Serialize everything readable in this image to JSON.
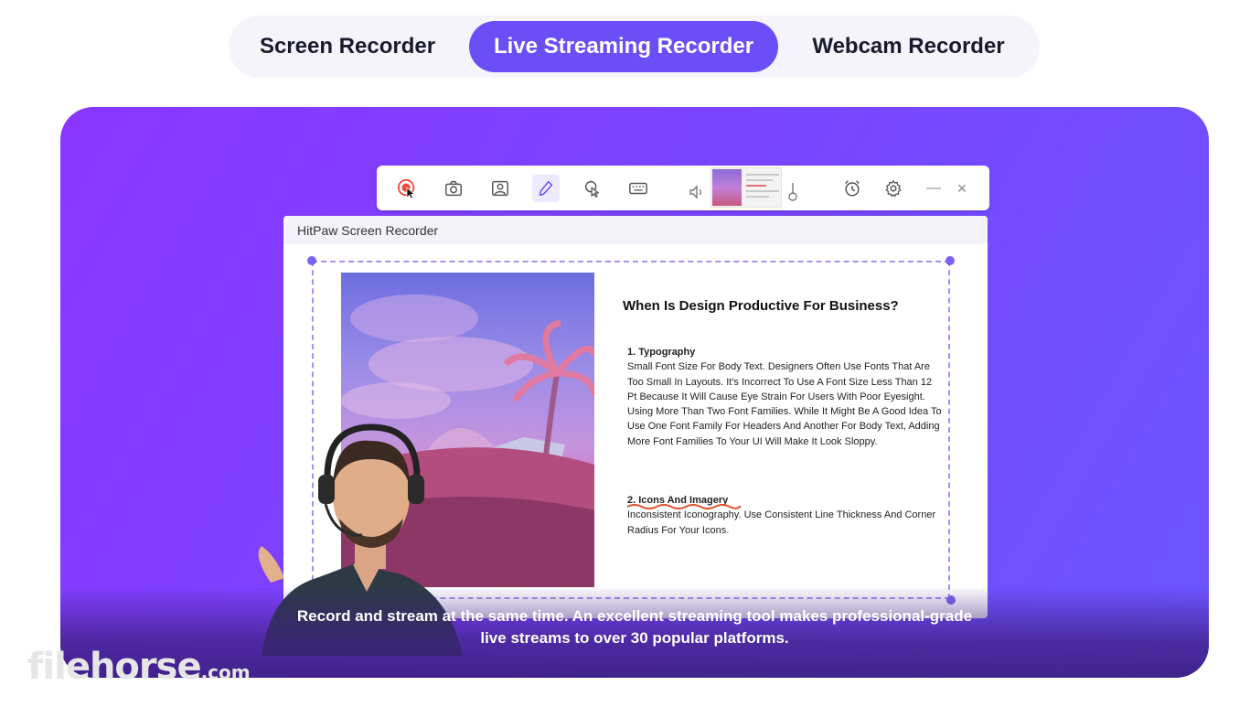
{
  "tabs": [
    {
      "label": "Screen Recorder",
      "active": false
    },
    {
      "label": "Live Streaming Recorder",
      "active": true
    },
    {
      "label": "Webcam Recorder",
      "active": false
    }
  ],
  "colors": {
    "accent": "#6b4ef6",
    "hero_gradient_start": "#8a36ff",
    "hero_gradient_end": "#6b55ff",
    "record_red": "#ef4b3c"
  },
  "toolbar": {
    "icons": [
      "record-icon",
      "camera-icon",
      "webcam-icon",
      "pen-icon",
      "cursor-click-icon",
      "keyboard-icon",
      "speaker-icon",
      "microphone-icon",
      "timer-icon",
      "settings-icon",
      "minimize-icon",
      "close-icon"
    ],
    "minimize_glyph": "—",
    "close_glyph": "×"
  },
  "app_window": {
    "title": "HitPaw Screen Recorder"
  },
  "document": {
    "title": "When Is Design Productive For Business?",
    "section1_heading": "1. Typography",
    "section1_body": "Small Font Size For Body Text. Designers Often Use Fonts That Are Too Small In Layouts. It's Incorrect To Use A Font Size Less Than 12 Pt Because It Will Cause Eye Strain For Users With Poor Eyesight.",
    "section1_body2": "Using More Than Two Font Families. While It Might Be A Good Idea To Use One Font Family For Headers And Another For Body Text, Adding More Font Families To Your UI Will Make It Look Sloppy.",
    "section2_heading": "2. Icons And Imagery",
    "section2_body": "Inconsistent Iconography. Use Consistent Line Thickness And Corner Radius For Your Icons."
  },
  "caption": {
    "line1": "Record and stream at the same time. An excellent streaming tool makes professional-grade",
    "line2": "live streams to over 30 popular platforms."
  },
  "watermark": {
    "text": "filehorse",
    "suffix": ".com"
  }
}
